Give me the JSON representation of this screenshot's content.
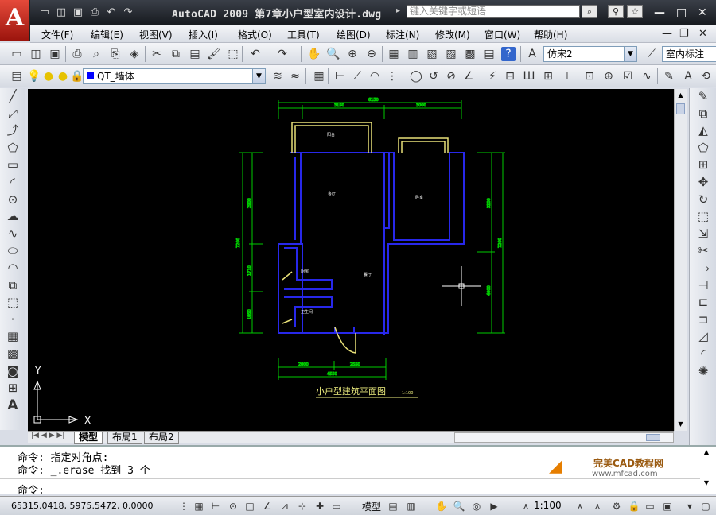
{
  "app": {
    "logo": "A",
    "title": "AutoCAD 2009  第7章小户型室内设计.dwg",
    "search_placeholder": "键入关键字或短语"
  },
  "quick_access": [
    "new-icon",
    "open-icon",
    "save-icon",
    "print-icon",
    "undo-icon",
    "redo-icon"
  ],
  "menu": [
    "文件(F)",
    "编辑(E)",
    "视图(V)",
    "插入(I)",
    "格式(O)",
    "工具(T)",
    "绘图(D)",
    "标注(N)",
    "修改(M)",
    "窗口(W)",
    "帮助(H)"
  ],
  "toolbar": {
    "text_style": "仿宋2",
    "dim_style": "室内标注",
    "layer": "QT_墙体"
  },
  "drawing": {
    "title": "小户型建筑平面图",
    "scale": "1:100",
    "rooms": [
      "阳台",
      "客厅",
      "卧室",
      "厨房",
      "餐厅",
      "卫生间"
    ],
    "dims_top": [
      "6150",
      "3150",
      "3000"
    ],
    "dims_bottom": [
      "2000",
      "2550",
      "4550"
    ],
    "dims_left": [
      "7200",
      "1710",
      "2900",
      "1050"
    ],
    "dims_right": [
      "7200",
      "3200",
      "4000"
    ]
  },
  "tabs": [
    "模型",
    "布局1",
    "布局2"
  ],
  "axis": {
    "x": "X",
    "y": "Y"
  },
  "command": {
    "line1": "命令: 指定对角点:",
    "line2": "命令: _.erase 找到 3 个",
    "prompt": "命令:"
  },
  "watermark": {
    "cn": "完美CAD教程网",
    "url": "www.mfcad.com"
  },
  "status": {
    "coords": "65315.0418, 5975.5472, 0.0000",
    "model": "模型",
    "scale": "1:100"
  },
  "colors": {
    "wall": "#2020e0",
    "dim": "#00cc00",
    "window": "#f0f080",
    "background": "#000000"
  }
}
